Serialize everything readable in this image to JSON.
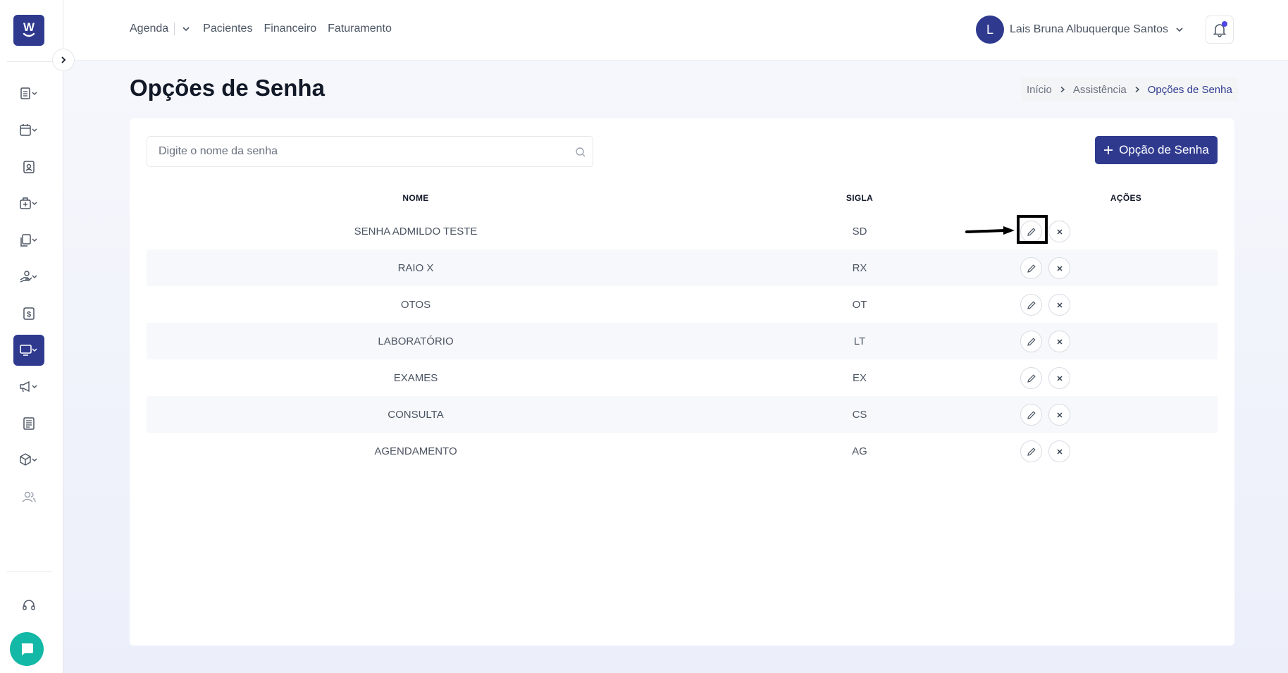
{
  "sidebar": {
    "logo_icon": "whatsapp-style-logo",
    "items": [
      {
        "icon": "clipboard-list-icon",
        "has_dropdown": true
      },
      {
        "icon": "calendar-icon",
        "has_dropdown": true
      },
      {
        "icon": "contact-card-icon",
        "has_dropdown": false
      },
      {
        "icon": "medical-bag-icon",
        "has_dropdown": true
      },
      {
        "icon": "documents-icon",
        "has_dropdown": true
      },
      {
        "icon": "hand-money-icon",
        "has_dropdown": true
      },
      {
        "icon": "dollar-doc-icon",
        "has_dropdown": false
      },
      {
        "icon": "monitor-icon",
        "has_dropdown": true,
        "active": true
      },
      {
        "icon": "megaphone-icon",
        "has_dropdown": true
      },
      {
        "icon": "newspaper-icon",
        "has_dropdown": false
      },
      {
        "icon": "box-icon",
        "has_dropdown": true
      },
      {
        "icon": "users-icon",
        "has_dropdown": false
      }
    ],
    "support_icon": "headset-icon",
    "chat_icon": "chat-bubble-icon"
  },
  "topnav": {
    "agenda": "Agenda",
    "pacientes": "Pacientes",
    "financeiro": "Financeiro",
    "faturamento": "Faturamento"
  },
  "user": {
    "initial": "L",
    "name": "Lais Bruna Albuquerque Santos"
  },
  "page": {
    "title": "Opções de Senha"
  },
  "breadcrumb": {
    "home": "Início",
    "section": "Assistência",
    "current": "Opções de Senha"
  },
  "search": {
    "placeholder": "Digite o nome da senha",
    "value": ""
  },
  "add_button": {
    "label": "Opção de Senha"
  },
  "table": {
    "headers": {
      "nome": "NOME",
      "sigla": "SIGLA",
      "acoes": "AÇÕES"
    },
    "rows": [
      {
        "nome": "SENHA ADMILDO TESTE",
        "sigla": "SD"
      },
      {
        "nome": "RAIO X",
        "sigla": "RX"
      },
      {
        "nome": "OTOS",
        "sigla": "OT"
      },
      {
        "nome": "LABORATÓRIO",
        "sigla": "LT"
      },
      {
        "nome": "EXAMES",
        "sigla": "EX"
      },
      {
        "nome": "CONSULTA",
        "sigla": "CS"
      },
      {
        "nome": "AGENDAMENTO",
        "sigla": "AG"
      }
    ]
  },
  "colors": {
    "brand": "#2f3a8f",
    "chat": "#14b8a6",
    "notification_dot": "#4f46e5"
  }
}
